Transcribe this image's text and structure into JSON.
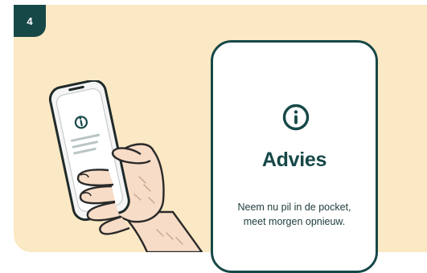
{
  "step": {
    "number": "4"
  },
  "advice": {
    "title": "Advies",
    "line1": "Neem nu pil in de pocket,",
    "line2": "meet morgen opnieuw."
  },
  "icons": {
    "advice_icon": "info-circle-icon",
    "phone_screen_icon": "info-circle-icon"
  },
  "colors": {
    "background": "#fbe8c4",
    "accent": "#174848",
    "card": "#ffffff",
    "skin": "#f7dcc7"
  }
}
